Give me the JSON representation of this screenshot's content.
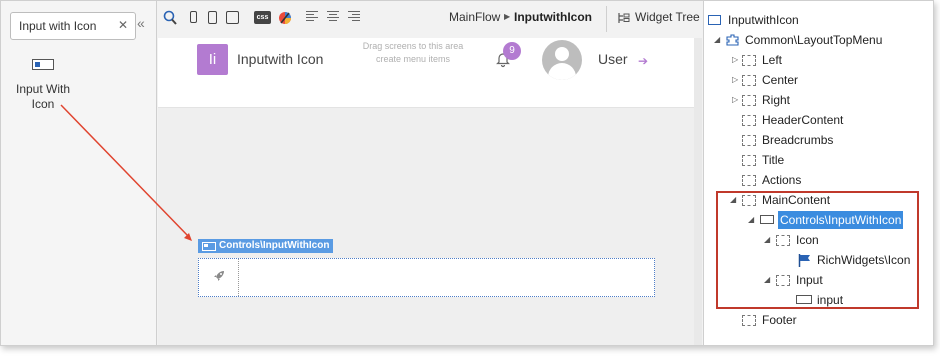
{
  "toolbox": {
    "search_value": "Input with Icon",
    "clear_glyph": "✕",
    "collapse_glyph": "«",
    "widget_label": "Input With Icon"
  },
  "toolbar": {
    "flow": "MainFlow",
    "separator": "▶",
    "screen": "InputwithIcon",
    "css_label": "css",
    "widget_tree_tab": "Widget Tree"
  },
  "canvas": {
    "logo_letter": "Ii",
    "app_name": "Inputwith Icon",
    "drag_hint": "Drag screens to this area create menu items",
    "notification_count": "9",
    "user_name": "User",
    "logout_glyph": "➔",
    "control_label": "Controls\\InputWithIcon",
    "rocket_glyph": "🚀"
  },
  "tree": {
    "root": "InputwithIcon",
    "layout": "Common\\LayoutTopMenu",
    "left": "Left",
    "center": "Center",
    "right": "Right",
    "header_content": "HeaderContent",
    "breadcrumbs": "Breadcrumbs",
    "title": "Title",
    "actions": "Actions",
    "main_content": "MainContent",
    "control": "Controls\\InputWithIcon",
    "icon": "Icon",
    "rich_widgets_icon": "RichWidgets\\Icon",
    "input": "Input",
    "input_widget": "input",
    "footer": "Footer"
  },
  "colors": {
    "accent_purple": "#b37bd1",
    "selection_blue": "#3b8cdf",
    "highlight_red": "#c0392b",
    "arrow_red": "#e0442f"
  }
}
